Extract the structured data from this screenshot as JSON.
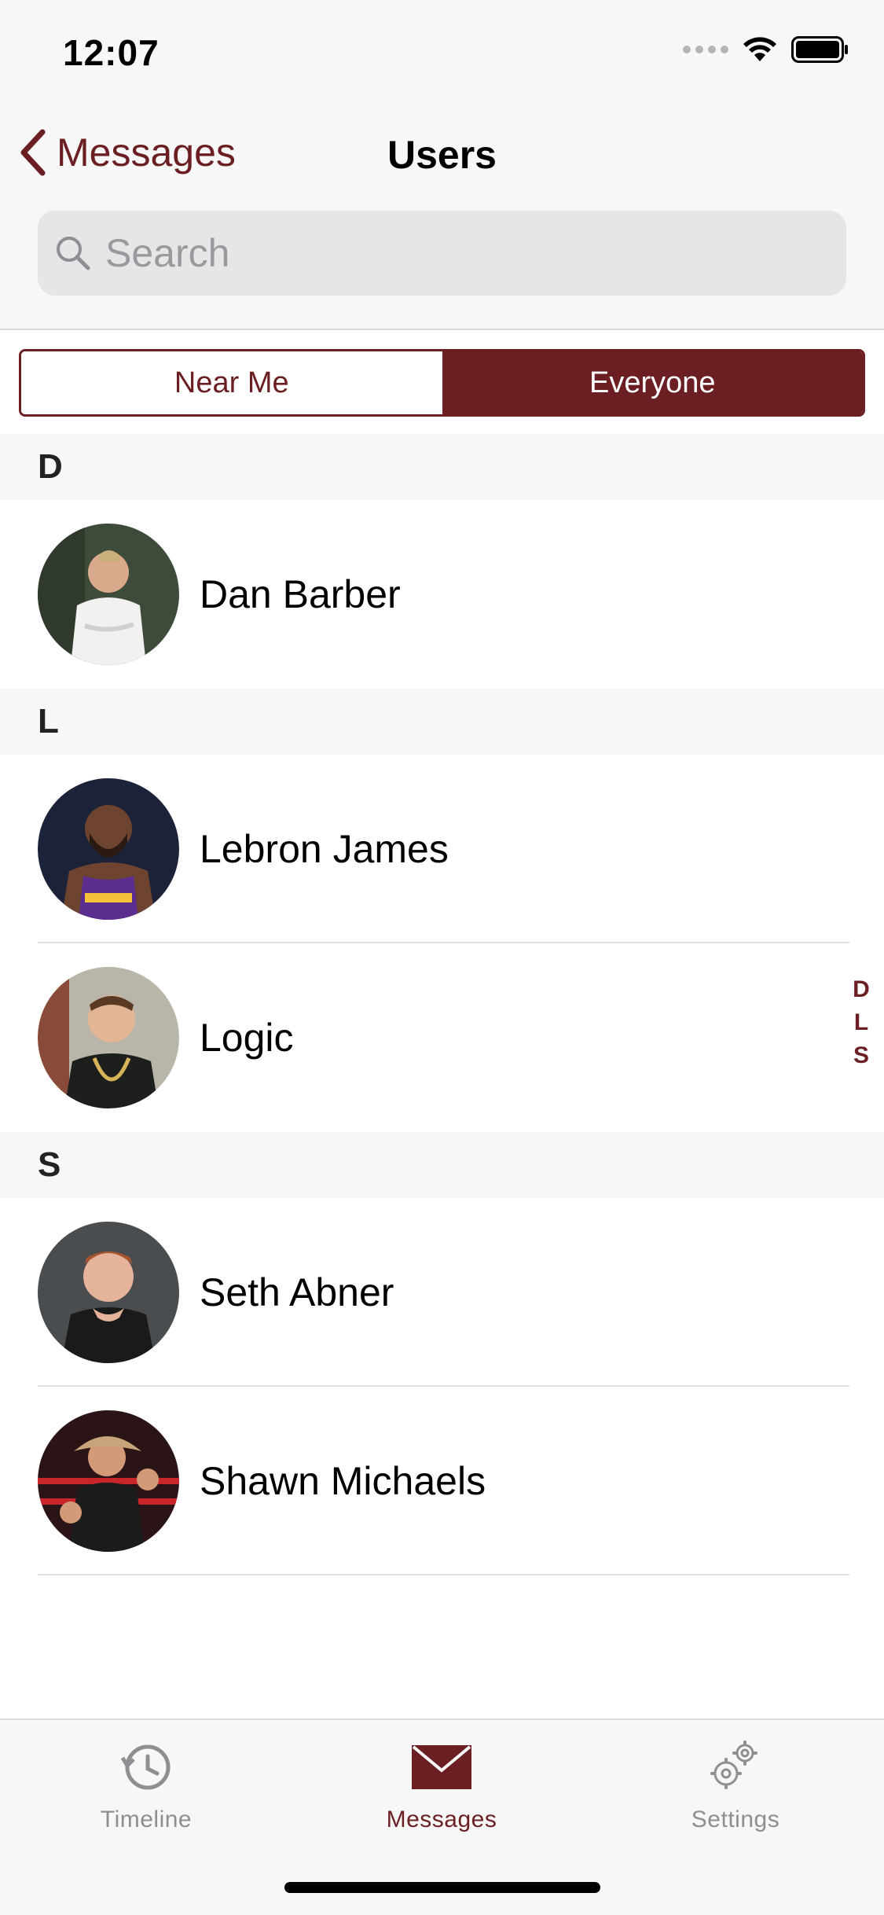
{
  "status_bar": {
    "time": "12:07"
  },
  "nav": {
    "back_label": "Messages",
    "title": "Users"
  },
  "search": {
    "placeholder": "Search"
  },
  "segment": {
    "options": [
      "Near Me",
      "Everyone"
    ],
    "selected": "Everyone"
  },
  "sections": [
    {
      "letter": "D",
      "users": [
        {
          "name": "Dan Barber"
        }
      ]
    },
    {
      "letter": "L",
      "users": [
        {
          "name": "Lebron James"
        },
        {
          "name": "Logic"
        }
      ]
    },
    {
      "letter": "S",
      "users": [
        {
          "name": "Seth Abner"
        },
        {
          "name": "Shawn Michaels"
        }
      ]
    }
  ],
  "index_letters": [
    "D",
    "L",
    "S"
  ],
  "tab_bar": {
    "tabs": [
      {
        "label": "Timeline",
        "icon": "timeline-clock-icon",
        "active": false
      },
      {
        "label": "Messages",
        "icon": "envelope-icon",
        "active": true
      },
      {
        "label": "Settings",
        "icon": "gears-icon",
        "active": false
      }
    ]
  },
  "colors": {
    "accent": "#6b1f22",
    "inactive": "#8e8e93",
    "bar_background": "#f7f7f7"
  }
}
